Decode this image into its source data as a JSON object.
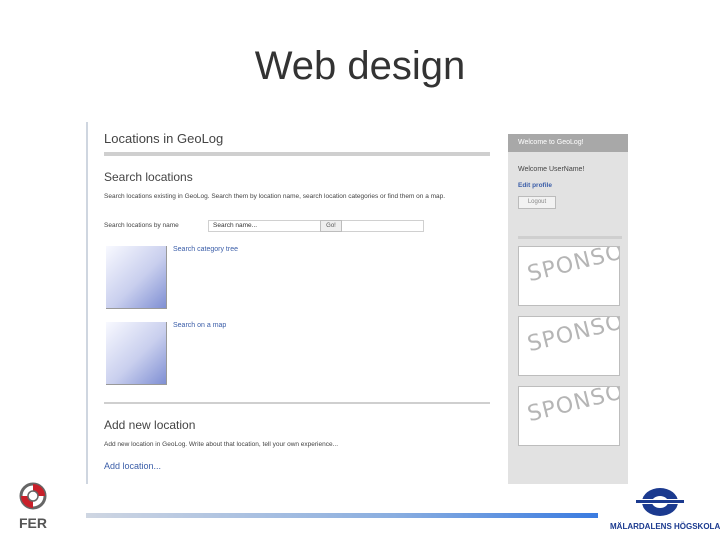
{
  "slide": {
    "title": "Web design"
  },
  "page": {
    "title": "Locations in GeoLog",
    "search_heading": "Search locations",
    "search_description": "Search locations existing in GeoLog. Search them by location name, search location categories or find them on a map.",
    "search_label": "Search locations by name",
    "search_placeholder": "Search name...",
    "go_label": "Go!",
    "category_link": "Search category tree",
    "map_link": "Search on a map",
    "add_heading": "Add new location",
    "add_description": "Add new location in GeoLog. Write about that location, tell your own experience...",
    "add_link": "Add location..."
  },
  "sidebar": {
    "header": "Welcome to GeoLog!",
    "welcome": "Welcome UserName!",
    "edit_profile": "Edit profile",
    "logout": "Logout",
    "sponsors": [
      "SPONSOR",
      "SPONSOR",
      "SPONSOR"
    ]
  },
  "footer": {
    "left_logo_text": "FER",
    "right_logo_text": "MÄLARDALENS HÖGSKOLA"
  },
  "colors": {
    "link": "#3a5da8",
    "sidebar_header": "#a8a8a8",
    "footer_bar": "#3a7be0"
  }
}
